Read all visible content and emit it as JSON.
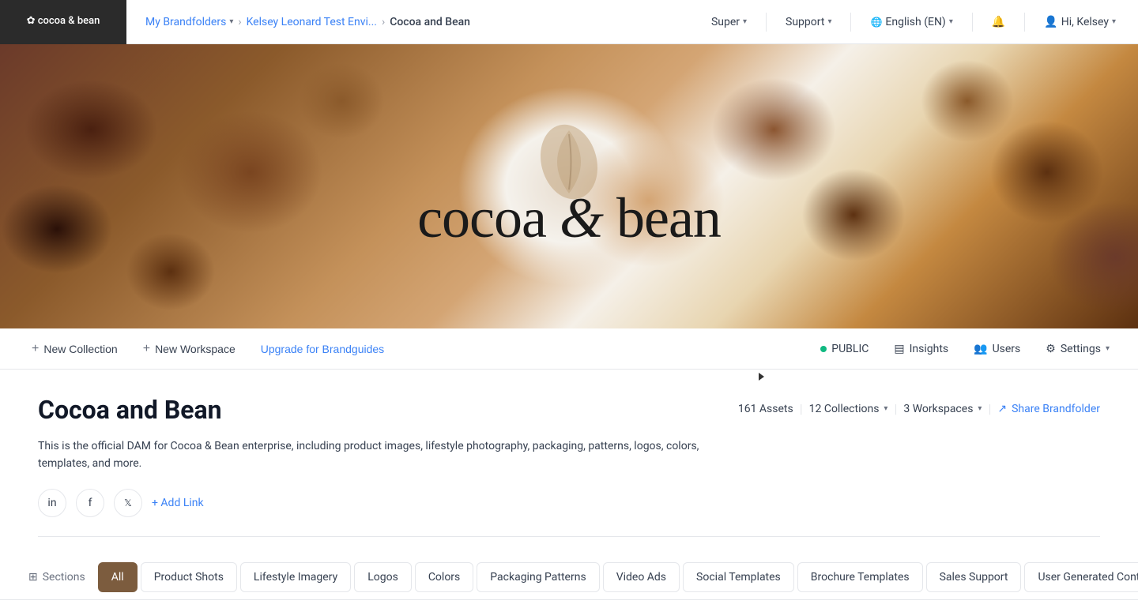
{
  "nav": {
    "logo_line1": "cocoa & bean",
    "brandfolders_label": "My Brandfolders",
    "env_label": "Kelsey Leonard Test Envi...",
    "current_label": "Cocoa and Bean",
    "super_label": "Super",
    "support_label": "Support",
    "language_label": "English (EN)",
    "user_label": "Hi, Kelsey"
  },
  "actionbar": {
    "new_collection": "New Collection",
    "new_workspace": "New Workspace",
    "upgrade_brandguides": "Upgrade for Brandguides",
    "public_label": "PUBLIC",
    "insights_label": "Insights",
    "users_label": "Users",
    "settings_label": "Settings"
  },
  "main": {
    "title": "Cocoa and Bean",
    "assets_count": "161 Assets",
    "collections_count": "12 Collections",
    "workspaces_count": "3 Workspaces",
    "share_label": "Share Brandfolder",
    "description": "This is the official DAM for Cocoa & Bean enterprise, including product images, lifestyle photography, packaging, patterns, logos, colors, templates, and more.",
    "add_link_label": "+ Add Link"
  },
  "tabs": {
    "sections_label": "Sections",
    "all_label": "All",
    "tabs": [
      {
        "label": "Product Shots",
        "active": false
      },
      {
        "label": "Lifestyle Imagery",
        "active": false
      },
      {
        "label": "Logos",
        "active": false
      },
      {
        "label": "Colors",
        "active": false
      },
      {
        "label": "Packaging Patterns",
        "active": false
      },
      {
        "label": "Video Ads",
        "active": false
      },
      {
        "label": "Social Templates",
        "active": false
      },
      {
        "label": "Brochure Templates",
        "active": false
      },
      {
        "label": "Sales Support",
        "active": false
      },
      {
        "label": "User Generated Content",
        "active": false
      }
    ]
  },
  "hero": {
    "title_part1": "cocoa",
    "title_amp": "&",
    "title_part2": "bean"
  },
  "collections_label": "Collections",
  "insights_label": "Insights"
}
